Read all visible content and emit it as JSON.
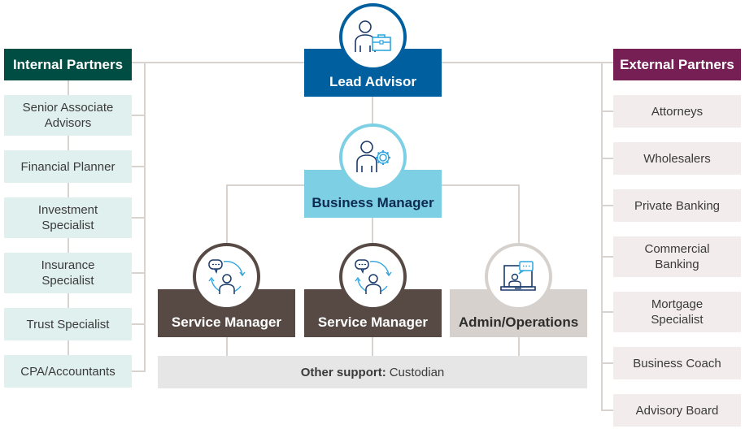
{
  "colors": {
    "internal_header": "#004d44",
    "internal_item": "#e0f0ef",
    "external_header": "#761f55",
    "external_item": "#f3eced",
    "lead_advisor": "#005f9e",
    "business_manager": "#7dd0e3",
    "service_manager": "#574a45",
    "admin_operations": "#d6d1cc",
    "other_support": "#e6e6e6",
    "connector": "#d9d3cf",
    "icon_dark": "#1a3a6b",
    "icon_accent": "#2fa6e0"
  },
  "internal_partners": {
    "title": "Internal Partners",
    "items": [
      {
        "label": "Senior Associate Advisors"
      },
      {
        "label": "Financial Planner"
      },
      {
        "label": "Investment Specialist"
      },
      {
        "label": "Insurance Specialist"
      },
      {
        "label": "Trust Specialist"
      },
      {
        "label": "CPA/Accountants"
      }
    ]
  },
  "external_partners": {
    "title": "External Partners",
    "items": [
      {
        "label": "Attorneys"
      },
      {
        "label": "Wholesalers"
      },
      {
        "label": "Private Banking"
      },
      {
        "label": "Commercial Banking"
      },
      {
        "label": "Mortgage Specialist"
      },
      {
        "label": "Business Coach"
      },
      {
        "label": "Advisory Board"
      }
    ]
  },
  "roles": {
    "lead_advisor": {
      "label": "Lead Advisor",
      "icon": "person-briefcase-icon"
    },
    "business_manager": {
      "label": "Business Manager",
      "icon": "person-gear-icon"
    },
    "service_manager_1": {
      "label": "Service Manager",
      "icon": "person-chat-cycle-icon"
    },
    "service_manager_2": {
      "label": "Service Manager",
      "icon": "person-chat-cycle-icon"
    },
    "admin_operations": {
      "label": "Admin/Operations",
      "icon": "laptop-video-chat-icon"
    }
  },
  "other_support": {
    "label": "Other support:",
    "value": "Custodian"
  }
}
